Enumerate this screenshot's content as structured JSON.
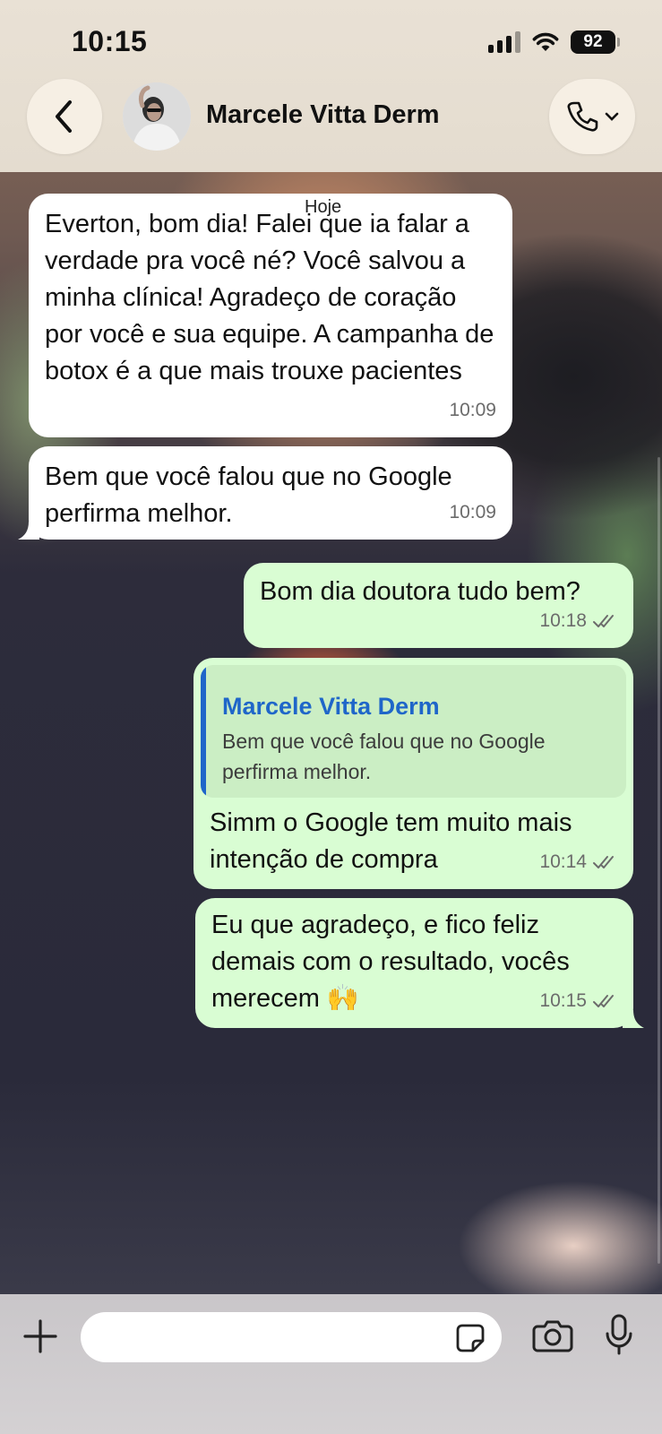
{
  "status_bar": {
    "time": "10:15",
    "battery": "92"
  },
  "header": {
    "contact_name": "Marcele Vitta Derm"
  },
  "chat": {
    "date_label": "Hoje",
    "messages": [
      {
        "text": "Everton, bom dia! Falei que ia falar a verdade pra você né? Você salvou a minha clínica! Agradeço de coração por você e sua equipe. A campanha de botox é a que mais trouxe pacientes",
        "time": "10:09"
      },
      {
        "text": "Bem que você falou que no Google perfirma melhor.",
        "time": "10:09"
      },
      {
        "text": "Bom dia doutora tudo bem?",
        "time": "10:18"
      },
      {
        "quote_name": "Marcele Vitta Derm",
        "quote_text": "Bem que você falou que no Google perfirma melhor.",
        "text": "Simm o Google tem muito mais intenção de compra",
        "time": "10:14"
      },
      {
        "text": "Eu que agradeço, e fico feliz demais com o resultado, vocês merecem 🙌",
        "time": "10:15"
      }
    ]
  },
  "composer": {
    "placeholder": ""
  },
  "icons": {
    "back": "chevron-left-icon",
    "call": "phone-icon",
    "plus": "plus-icon",
    "sticker": "sticker-icon",
    "camera": "camera-icon",
    "mic": "microphone-icon"
  },
  "colors": {
    "incoming": "#ffffff",
    "outgoing": "#d9fdd3",
    "quote_accent": "#1f66c9"
  }
}
